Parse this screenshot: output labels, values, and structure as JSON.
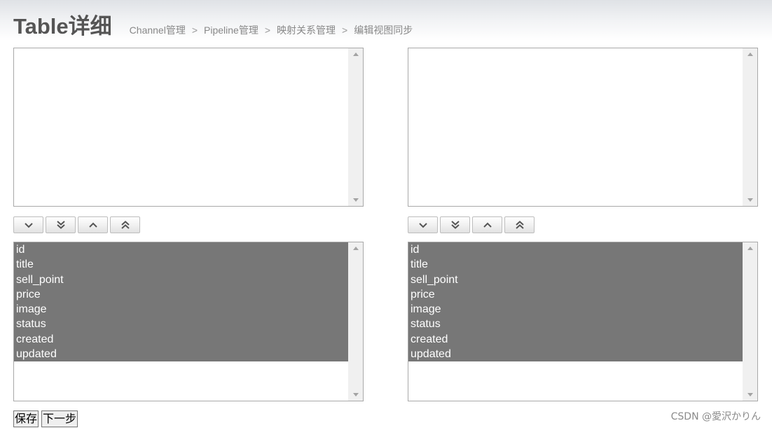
{
  "header": {
    "title": "Table详细",
    "breadcrumb": [
      "Channel管理",
      "Pipeline管理",
      "映射关系管理",
      "编辑视图同步"
    ],
    "separator": ">"
  },
  "left_panel": {
    "top_list": {
      "items": []
    },
    "bottom_list": {
      "items": [
        "id",
        "title",
        "sell_point",
        "price",
        "image",
        "status",
        "created",
        "updated"
      ],
      "selected": true
    }
  },
  "right_panel": {
    "top_list": {
      "items": []
    },
    "bottom_list": {
      "items": [
        "id",
        "title",
        "sell_point",
        "price",
        "image",
        "status",
        "created",
        "updated"
      ],
      "selected": true
    }
  },
  "move_buttons": [
    "chevron-down-icon",
    "double-chevron-down-icon",
    "chevron-up-icon",
    "double-chevron-up-icon"
  ],
  "actions": {
    "save_label": "保存",
    "next_label": "下一步"
  },
  "watermark": "CSDN @愛沢かりん",
  "colors": {
    "selected_bg": "#777777",
    "selected_text": "#ffffff",
    "title": "#555555",
    "breadcrumb": "#888888"
  }
}
